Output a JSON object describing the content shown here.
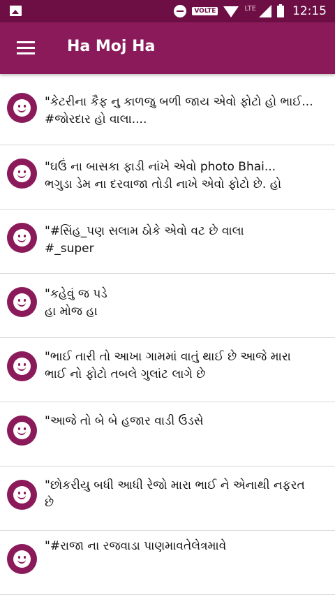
{
  "status_bar": {
    "volte": "VOLTE",
    "lte": "LTE",
    "time": "12:15",
    "icons": [
      "image-icon",
      "do-not-disturb-icon",
      "wifi-icon",
      "signal-icon",
      "battery-icon"
    ]
  },
  "app_bar": {
    "title": "Ha Moj Ha",
    "menu_icon": "hamburger-menu-icon",
    "color": "#8b1a5a",
    "status_color": "#6d0f45"
  },
  "posts": [
    {
      "text": "\"કેટરીના કૈફ નુ કાળજુ બળી જાય એવો ફોટો હો ભાઈ...\n#જોરદાર હો વાલા...."
    },
    {
      "text": "\"ઘઉં ના બાસકા ફાડી નાંખે એવો photo Bhai...\nભગુડા ડેમ ના દરવાજા તોડી નાખે એવો ફોટો છે. હો"
    },
    {
      "text": "\"#સિંહ_પણ સલામ ઠોકે એવો વટ છે વાલા\n#_super"
    },
    {
      "text": "\"કહેવું જ પડે\nહા મોજ હા"
    },
    {
      "text": "\"ભાઈ તારી તો આખા ગામમાં વાતું થાઈ છે  આજે મારા\nભાઈ નો ફોટો તબલે ગુલાંટ લાગે છે"
    },
    {
      "text": "\"આજે તો બે બે હજાર વાડી ઉડસે"
    },
    {
      "text": "\"છોકરીયુ બધી આધી રેજો મારા ભાઈ ને એનાથી નફરત\nછે"
    },
    {
      "text": "\"#રાજા ના રજવાડા પાણમાવતેલેત્રમાવે"
    }
  ]
}
